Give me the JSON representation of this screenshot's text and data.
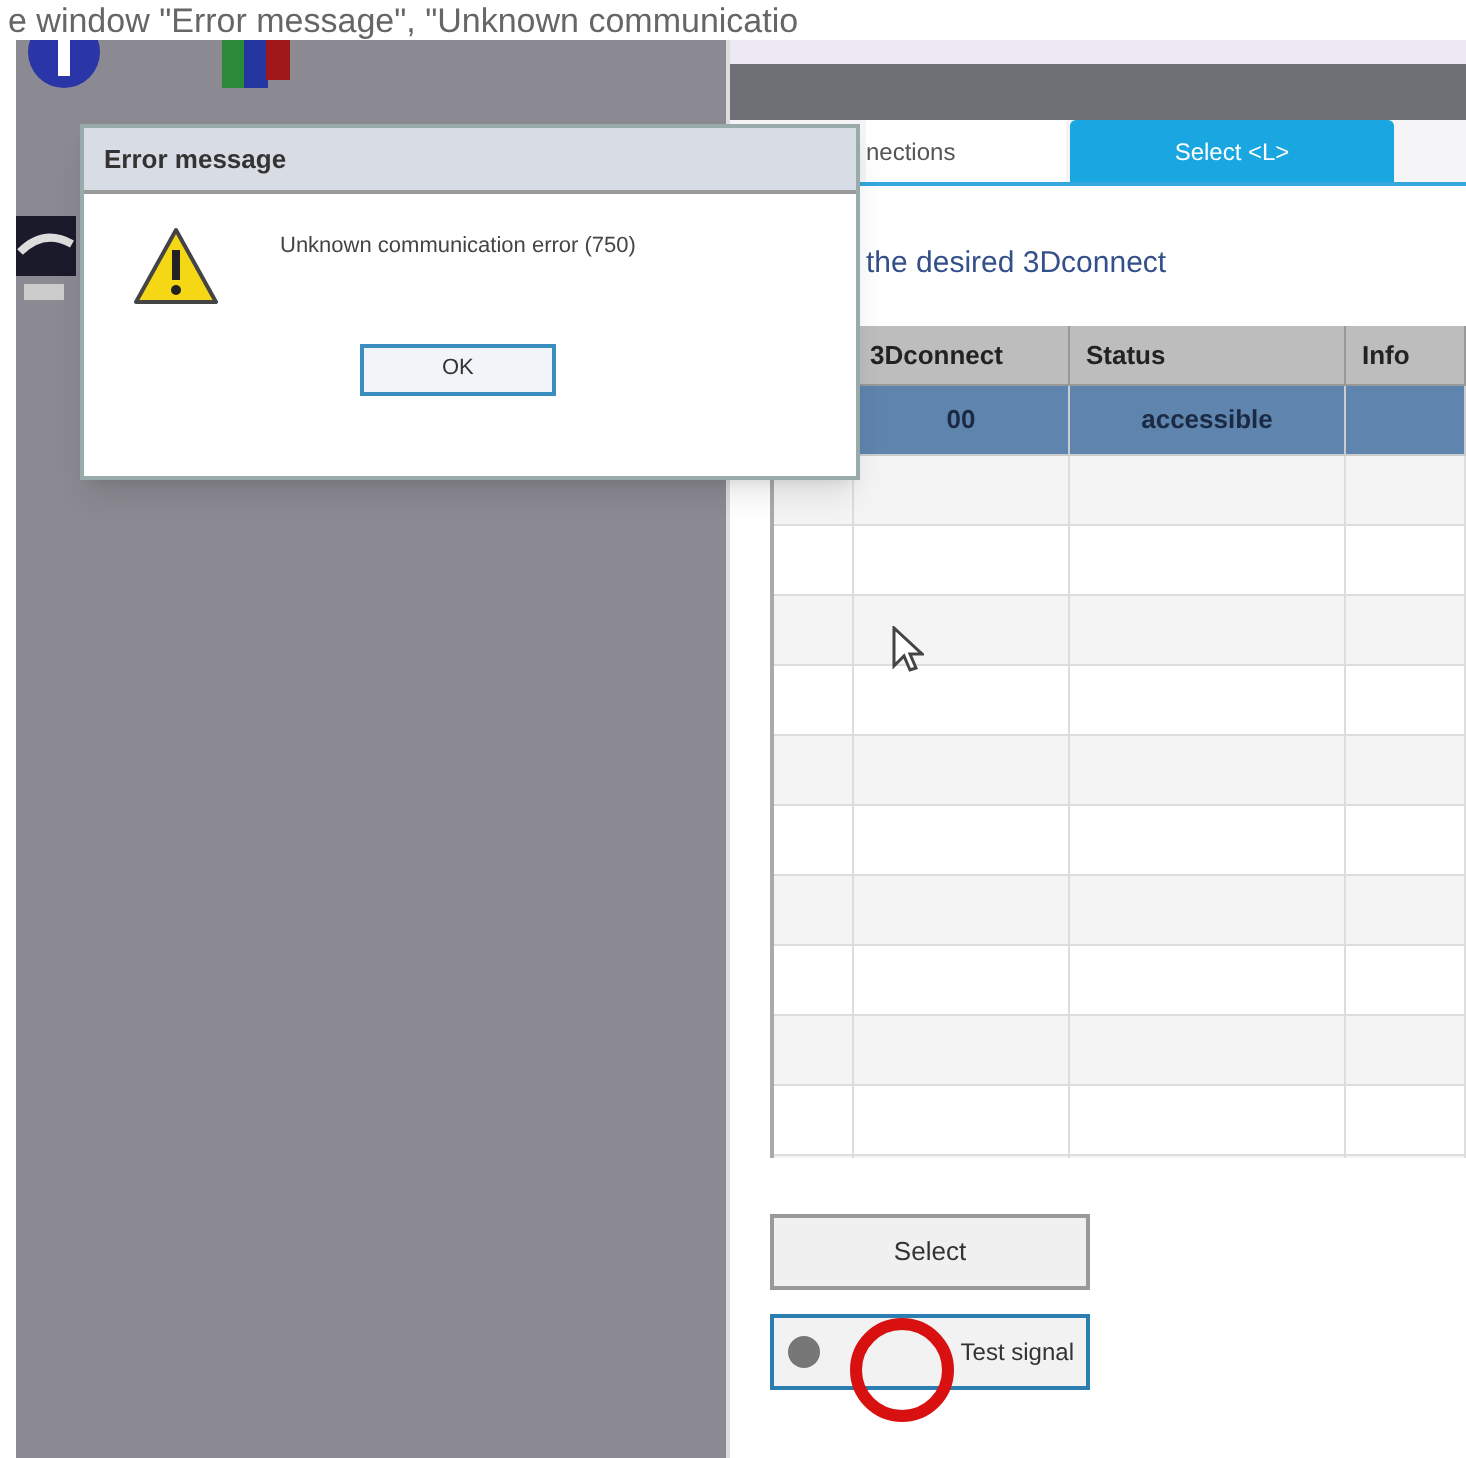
{
  "caption": "e window \"Error message\", \"Unknown communicatio",
  "app": {
    "tabs": [
      {
        "label": "nections",
        "selected": false
      },
      {
        "label": "Select <L>",
        "selected": true
      }
    ],
    "heading": "the desired 3Dconnect",
    "table": {
      "columns": [
        "3Dconnect",
        "Status",
        "Info"
      ],
      "rows": [
        {
          "cells": [
            "00",
            "accessible",
            ""
          ],
          "selected": true
        }
      ]
    },
    "buttons": [
      {
        "label": "Select",
        "kind": "plain"
      },
      {
        "label": "Test signal",
        "kind": "icon"
      }
    ]
  },
  "dialog": {
    "title": "Error message",
    "message": "Unknown communication error (750)",
    "button": "OK"
  }
}
